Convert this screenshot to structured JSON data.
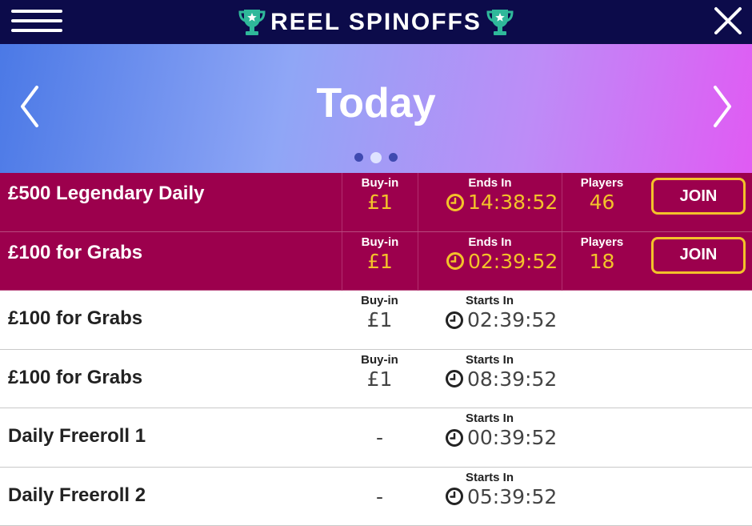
{
  "header": {
    "title": "REEL SPINOFFS",
    "menu_icon": "hamburger-menu-icon",
    "close_icon": "close-icon",
    "trophy_icon": "trophy-icon"
  },
  "banner": {
    "title": "Today",
    "prev_icon": "chevron-left-icon",
    "next_icon": "chevron-right-icon",
    "pages": 3,
    "active_page": 2
  },
  "labels": {
    "buyin": "Buy-in",
    "ends_in": "Ends In",
    "starts_in": "Starts In",
    "players": "Players",
    "join": "JOIN"
  },
  "rows": [
    {
      "name": "£500 Legendary Daily",
      "buyin": "£1",
      "time_label": "Ends In",
      "time": "14:38:52",
      "players": "46",
      "join": "JOIN"
    },
    {
      "name": "£100 for Grabs",
      "buyin": "£1",
      "time_label": "Ends In",
      "time": "02:39:52",
      "players": "18",
      "join": "JOIN"
    },
    {
      "name": "£100 for Grabs",
      "buyin": "£1",
      "time_label": "Starts In",
      "time": "02:39:52"
    },
    {
      "name": "£100 for Grabs",
      "buyin": "£1",
      "time_label": "Starts In",
      "time": "08:39:52"
    },
    {
      "name": "Daily Freeroll 1",
      "buyin": "-",
      "time_label": "Starts In",
      "time": "00:39:52"
    },
    {
      "name": "Daily Freeroll 2",
      "buyin": "-",
      "time_label": "Starts In",
      "time": "05:39:52"
    }
  ],
  "colors": {
    "header_bg": "#0c0b4a",
    "featured_row_bg": "#9c004d",
    "accent_gold": "#f3c22a",
    "trophy_green": "#2fb89a"
  }
}
